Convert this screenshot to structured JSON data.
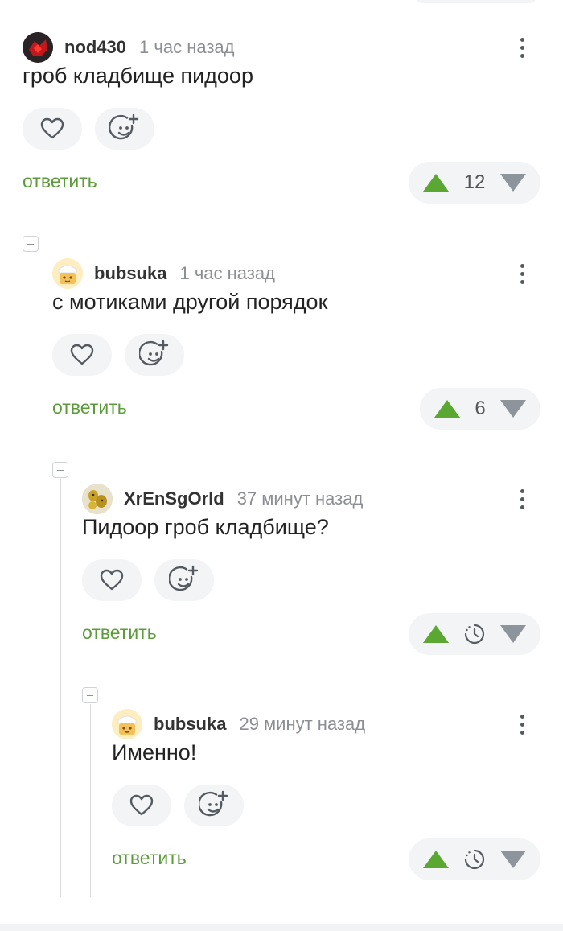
{
  "comments": [
    {
      "username": "nod430",
      "time": "1 час назад",
      "text": "гроб кладбище пидоор",
      "reply_label": "ответить",
      "rating": "12",
      "avatar_icon": "red-dark-avatar"
    },
    {
      "username": "bubsuka",
      "time": "1 час назад",
      "text": "с мотиками другой порядок",
      "reply_label": "ответить",
      "rating": "6",
      "avatar_icon": "cartoon-avatar"
    },
    {
      "username": "XrEnSgOrld",
      "time": "37 минут назад",
      "text": "Пидоор гроб кладбище?",
      "reply_label": "ответить",
      "rating_state": "pending",
      "avatar_icon": "photo-avatar"
    },
    {
      "username": "bubsuka",
      "time": "29 минут назад",
      "text": "Именно!",
      "reply_label": "ответить",
      "rating_state": "pending",
      "avatar_icon": "cartoon-avatar"
    }
  ],
  "colors": {
    "accent_green": "#5c9b3a",
    "vote_up": "#5aa832",
    "vote_down": "#8e949b",
    "pill_bg": "#f2f4f6"
  }
}
